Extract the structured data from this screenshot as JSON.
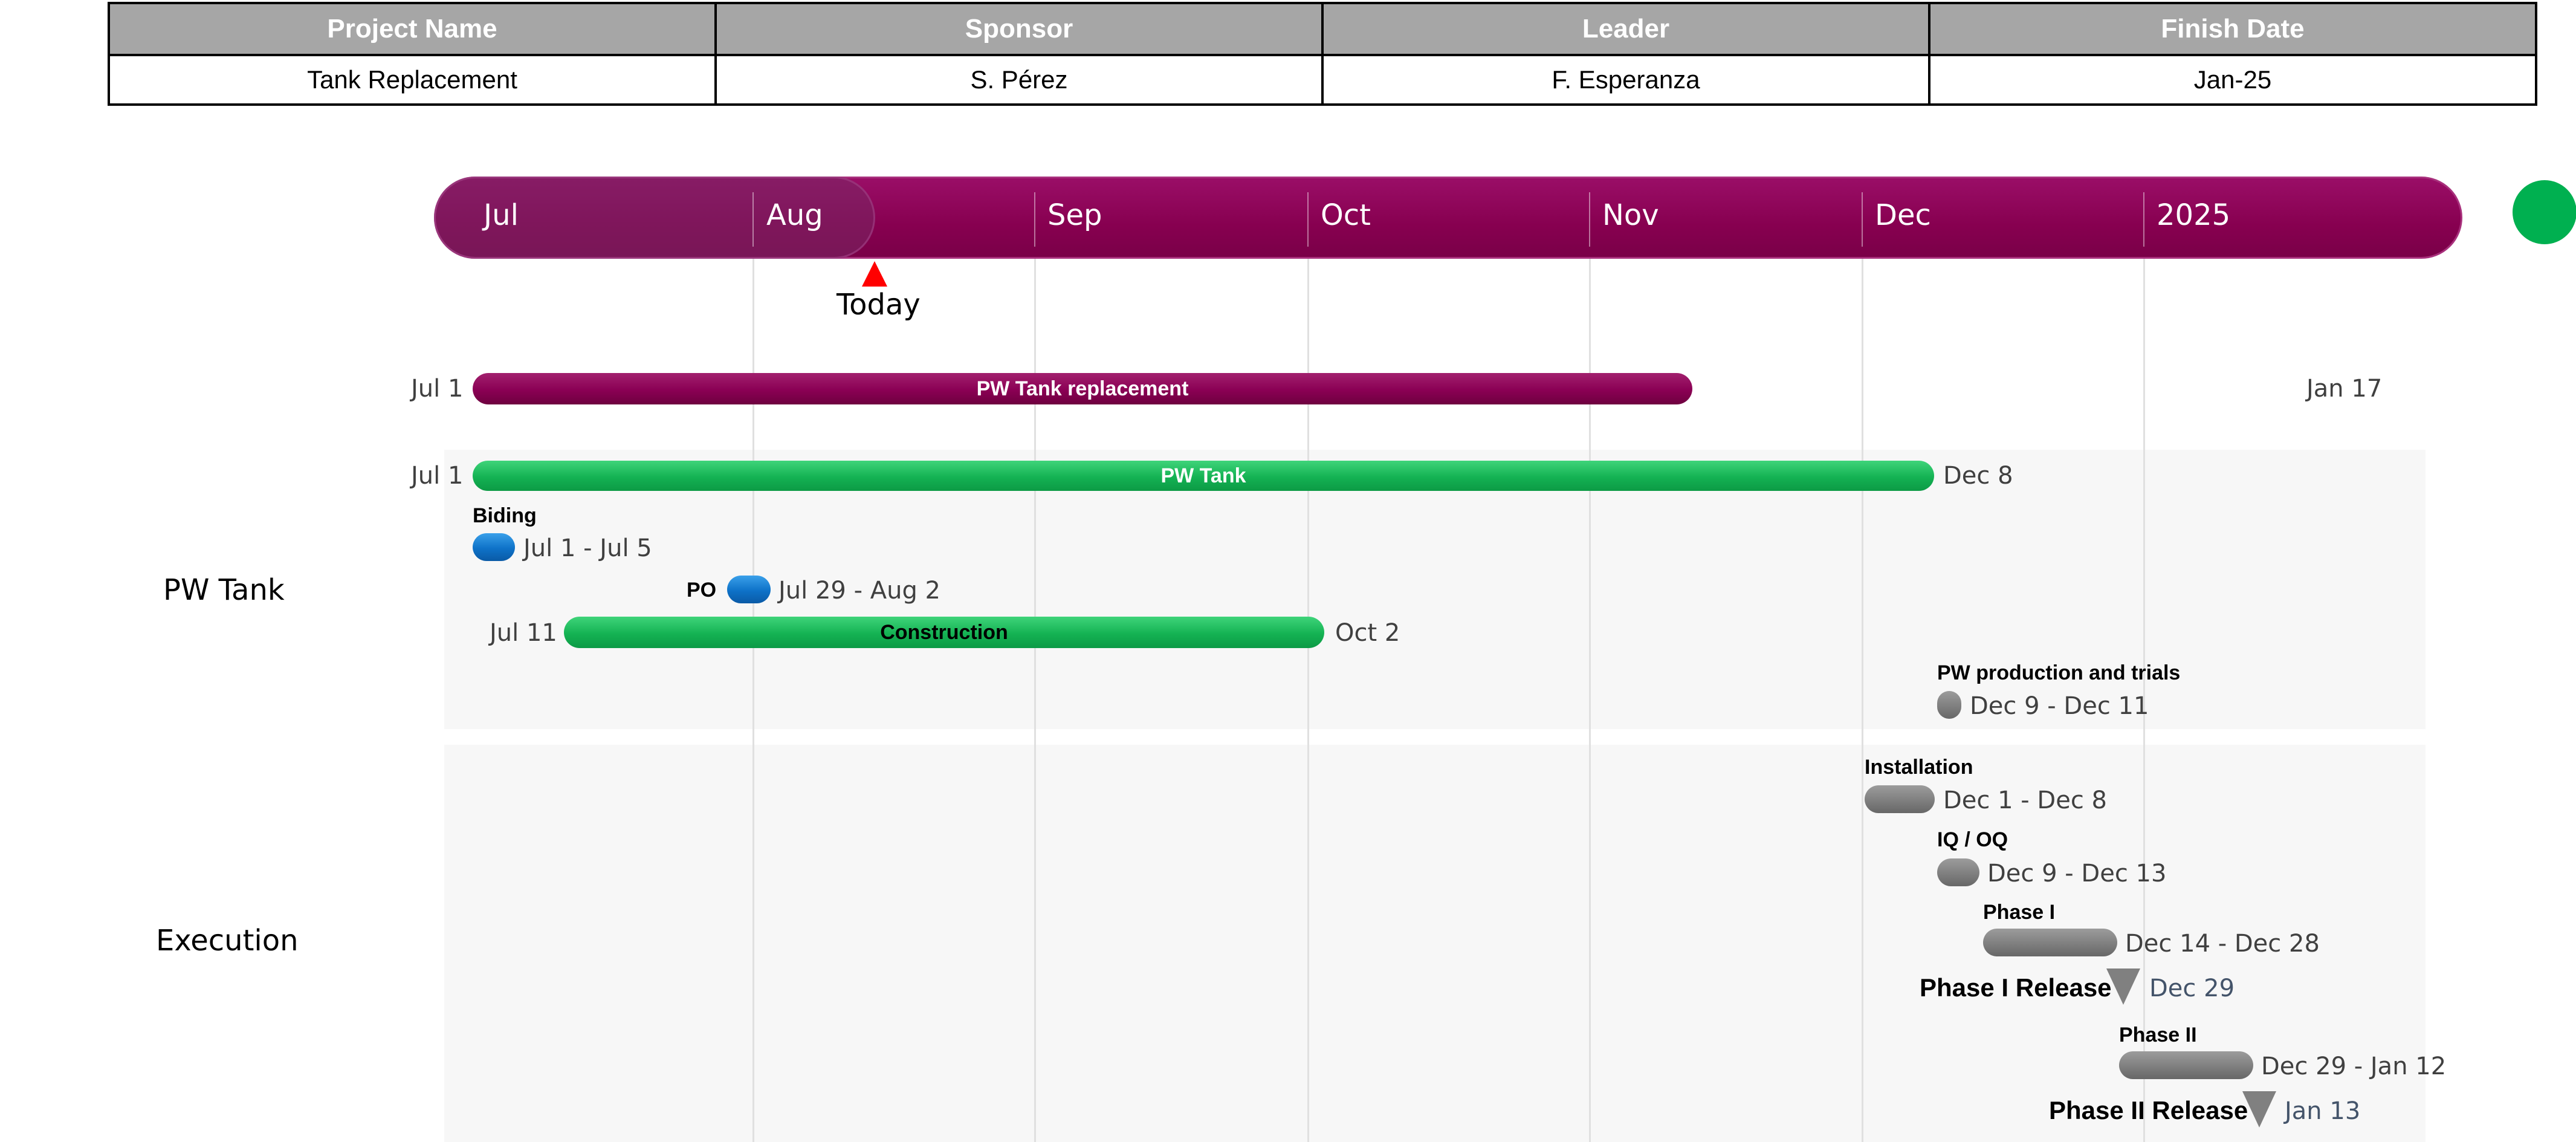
{
  "table": {
    "headers": [
      "Project Name",
      "Sponsor",
      "Leader",
      "Finish Date"
    ],
    "values": [
      "Tank Replacement",
      "S. Pérez",
      "F. Esperanza",
      "Jan-25"
    ]
  },
  "timescale": {
    "months": [
      "Jul",
      "Aug",
      "Sep",
      "Oct",
      "Nov",
      "Dec",
      "2025"
    ],
    "today_label": "Today"
  },
  "colors": {
    "timescale": "#870050",
    "status": "#00b050",
    "today": "#ff0000",
    "summary_bar": "#870050",
    "pw_tank_bar": "#14b253",
    "biding_po": "#0e72c8",
    "execution": "#7f7f7f"
  },
  "summary": {
    "label": "PW Tank replacement",
    "start": "Jul 1",
    "end": "Jan 17"
  },
  "lanes": {
    "pw_tank": {
      "title": "PW Tank",
      "bar": {
        "label": "PW Tank",
        "start": "Jul 1",
        "end": "Dec 8"
      },
      "biding": {
        "name": "Biding",
        "dates": "Jul 1 - Jul 5"
      },
      "po": {
        "name": "PO",
        "dates": "Jul 29 - Aug 2"
      },
      "construction": {
        "label": "Construction",
        "start": "Jul 11",
        "end": "Oct 2"
      },
      "production": {
        "name": "PW production and trials",
        "dates": "Dec 9 - Dec 11"
      }
    },
    "execution": {
      "title": "Execution",
      "installation": {
        "name": "Installation",
        "dates": "Dec 1 - Dec 8"
      },
      "iqoq": {
        "name": "IQ / OQ",
        "dates": "Dec 9 - Dec 13"
      },
      "phase1": {
        "name": "Phase I",
        "dates": "Dec 14 - Dec 28"
      },
      "phase1_release": {
        "name": "Phase I Release",
        "date": "Dec 29"
      },
      "phase2": {
        "name": "Phase II",
        "dates": "Dec 29 - Jan 12"
      },
      "phase2_release": {
        "name": "Phase II Release",
        "date": "Jan 13"
      }
    }
  }
}
